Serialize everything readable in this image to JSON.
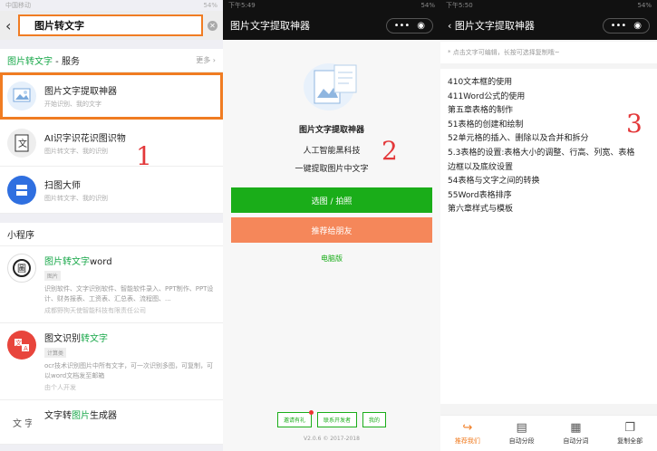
{
  "panel1": {
    "status_left": "中国移动",
    "status_right": "54%",
    "search_value": "图片转文字",
    "service_header": {
      "keyword": "图片转文字",
      "suffix": " - 服务",
      "more": "更多 ›"
    },
    "services": [
      {
        "name": "图片文字提取神器",
        "desc": "开始识别、我的文字",
        "icon": "image-doc-icon"
      },
      {
        "name": "AI识字识花识图识物",
        "desc": "图片转文字、我的识别",
        "icon": "text-scan-icon"
      },
      {
        "name": "扫图大师",
        "desc": "图片转文字、我的识别",
        "icon": "scanner-icon"
      }
    ],
    "mini_header": "小程序",
    "minis": [
      {
        "name_hl": "图片转文字",
        "name_rest": "word",
        "tag": "图片",
        "desc": "识别软件、文字识别软件、智能软件录入、PPT制作、PPT设计、财务报表、工资表、汇总表、流程图、...",
        "src": "成都野狗天使智能科技有限责任公司"
      },
      {
        "name_pre": "图文识别",
        "name_hl": "转文字",
        "tag": "计算类",
        "desc": "ocr技术识别图片中所有文字，可一次识别多图，可复制，可以word文档发至邮箱",
        "src": "由个人开发"
      },
      {
        "name_pre": "文字转",
        "name_hl": "图片",
        "name_rest": "生成器"
      }
    ],
    "step": "1"
  },
  "panel2": {
    "status_left": "下午5:49",
    "status_right": "54%",
    "title": "图片文字提取神器",
    "menu": "•••",
    "app_name": "图片文字提取神器",
    "slogan_1": "人工智能黑科技",
    "slogan_2": "一键提取图片中文字",
    "btn_select": "选图 / 拍照",
    "btn_share": "推荐给朋友",
    "link_pc": "电脑版",
    "footer": [
      "邀请有礼",
      "联系开发者",
      "我的"
    ],
    "version": "V2.0.6 © 2017-2018",
    "step": "2"
  },
  "panel3": {
    "status_left": "下午5:50",
    "status_right": "54%",
    "title": "图片文字提取神器",
    "menu": "•••",
    "hint": "* 点击文字可编辑，长按可选择复制哦~",
    "lines": [
      "410文本框的使用",
      "411Word公式的使用",
      "第五章表格的制作",
      "51表格的创建和绘制",
      "52单元格的插入、删除以及合并和拆分",
      "5.3表格的设置:表格大小的调整、行高、列宽、表格",
      "边框以及底纹设置",
      "54表格与文字之间的转换",
      "55Word表格排序",
      "第六章样式与模板"
    ],
    "tabs": [
      {
        "label": "推荐我们",
        "icon": "share-icon"
      },
      {
        "label": "自动分段",
        "icon": "paragraph-icon"
      },
      {
        "label": "自动分词",
        "icon": "split-words-icon"
      },
      {
        "label": "复制全部",
        "icon": "copy-icon"
      }
    ],
    "step": "3"
  }
}
